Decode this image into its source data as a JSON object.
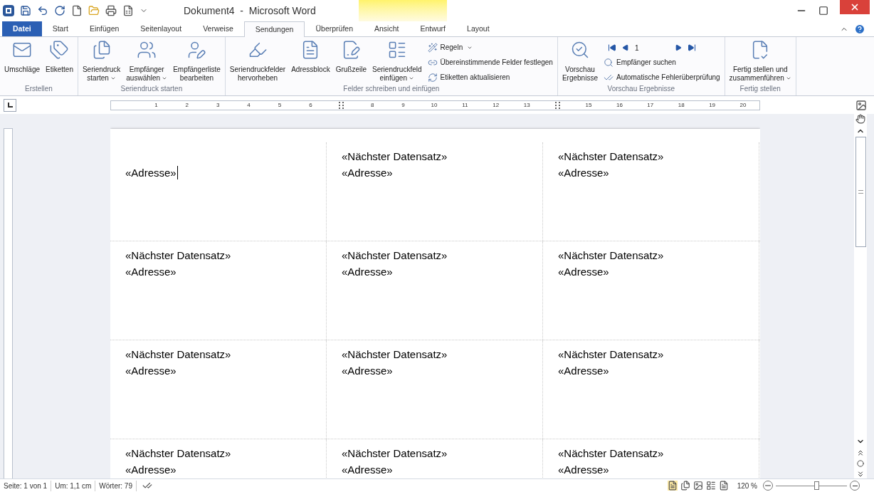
{
  "window": {
    "title": "Dokument4  -  Microsoft Word"
  },
  "tabs": [
    {
      "label": "Datei",
      "kind": "file",
      "selected": false
    },
    {
      "label": "Start",
      "kind": "tab",
      "selected": false
    },
    {
      "label": "Einfügen",
      "kind": "tab",
      "selected": false
    },
    {
      "label": "Seitenlayout",
      "kind": "tab",
      "selected": false
    },
    {
      "label": "Verweise",
      "kind": "tab",
      "selected": false
    },
    {
      "label": "Sendungen",
      "kind": "tab",
      "selected": true
    },
    {
      "label": "Überprüfen",
      "kind": "tab",
      "selected": false
    },
    {
      "label": "Ansicht",
      "kind": "tab",
      "selected": false
    },
    {
      "label": "Entwurf",
      "kind": "tab",
      "selected": false
    },
    {
      "label": "Layout",
      "kind": "tab",
      "selected": false
    }
  ],
  "ribbon": [
    {
      "label": "Erstellen",
      "items": [
        {
          "kind": "large",
          "lines": [
            "Umschläge"
          ],
          "dropdown": false
        },
        {
          "kind": "large",
          "lines": [
            "Etiketten"
          ],
          "dropdown": false
        }
      ]
    },
    {
      "label": "Seriendruck starten",
      "items": [
        {
          "kind": "large",
          "lines": [
            "Seriendruck",
            "starten"
          ],
          "dropdown": true
        },
        {
          "kind": "large",
          "lines": [
            "Empfänger",
            "auswählen"
          ],
          "dropdown": true
        },
        {
          "kind": "large",
          "lines": [
            "Empfängerliste",
            "bearbeiten"
          ],
          "dropdown": false
        }
      ]
    },
    {
      "label": "Felder schreiben und einfügen",
      "items": [
        {
          "kind": "large",
          "lines": [
            "Seriendruckfelder",
            "hervorheben"
          ],
          "dropdown": false
        },
        {
          "kind": "large",
          "lines": [
            "Adressblock"
          ],
          "dropdown": false
        },
        {
          "kind": "large",
          "lines": [
            "Grußzeile"
          ],
          "dropdown": false
        },
        {
          "kind": "large",
          "lines": [
            "Seriendruckfeld",
            "einfügen"
          ],
          "dropdown": true
        },
        {
          "kind": "small",
          "small": [
            {
              "label": "Regeln",
              "dropdown": true
            },
            {
              "label": "Übereinstimmende Felder festlegen",
              "dropdown": false
            },
            {
              "label": "Etiketten aktualisieren",
              "dropdown": false
            }
          ]
        }
      ]
    },
    {
      "label": "Vorschau Ergebnisse",
      "items": [
        {
          "kind": "large",
          "lines": [
            "Vorschau",
            "Ergebnisse"
          ],
          "dropdown": false
        },
        {
          "kind": "nav",
          "record": "1",
          "small": [
            {
              "label": "Empfänger suchen",
              "dropdown": false
            },
            {
              "label": "Automatische Fehlerüberprüfung",
              "dropdown": false
            }
          ]
        }
      ]
    },
    {
      "label": "Fertig stellen",
      "items": [
        {
          "kind": "large",
          "lines": [
            "Fertig stellen und",
            "zusammenführen"
          ],
          "dropdown": true
        }
      ]
    }
  ],
  "ruler": [
    {
      "kind": "number",
      "label": "1"
    },
    {
      "kind": "number",
      "label": "2"
    },
    {
      "kind": "number",
      "label": "3"
    },
    {
      "kind": "number",
      "label": "4"
    },
    {
      "kind": "number",
      "label": "5"
    },
    {
      "kind": "number",
      "label": "6"
    },
    {
      "kind": "column"
    },
    {
      "kind": "number",
      "label": "8"
    },
    {
      "kind": "number",
      "label": "9"
    },
    {
      "kind": "number",
      "label": "10"
    },
    {
      "kind": "number",
      "label": "11"
    },
    {
      "kind": "number",
      "label": "12"
    },
    {
      "kind": "number",
      "label": "13"
    },
    {
      "kind": "column"
    },
    {
      "kind": "number",
      "label": "15"
    },
    {
      "kind": "number",
      "label": "16"
    },
    {
      "kind": "number",
      "label": "17"
    },
    {
      "kind": "number",
      "label": "18"
    },
    {
      "kind": "number",
      "label": "19"
    },
    {
      "kind": "number",
      "label": "20"
    }
  ],
  "labels": [
    [
      {
        "lines": [
          "«Adresse»"
        ],
        "cursor": true
      },
      {
        "lines": [
          "«Nächster Datensatz»",
          "«Adresse»"
        ],
        "cursor": false
      },
      {
        "lines": [
          "«Nächster Datensatz»",
          "«Adresse»"
        ],
        "cursor": false
      }
    ],
    [
      {
        "lines": [
          "«Nächster Datensatz»",
          "«Adresse»"
        ],
        "cursor": false
      },
      {
        "lines": [
          "«Nächster Datensatz»",
          "«Adresse»"
        ],
        "cursor": false
      },
      {
        "lines": [
          "«Nächster Datensatz»",
          "«Adresse»"
        ],
        "cursor": false
      }
    ],
    [
      {
        "lines": [
          "«Nächster Datensatz»",
          "«Adresse»"
        ],
        "cursor": false
      },
      {
        "lines": [
          "«Nächster Datensatz»",
          "«Adresse»"
        ],
        "cursor": false
      },
      {
        "lines": [
          "«Nächster Datensatz»",
          "«Adresse»"
        ],
        "cursor": false
      }
    ],
    [
      {
        "lines": [
          "«Nächster Datensatz»",
          "«Adresse»"
        ],
        "cursor": false
      },
      {
        "lines": [
          "«Nächster Datensatz»",
          "«Adresse»"
        ],
        "cursor": false
      },
      {
        "lines": [
          "«Nächster Datensatz»",
          "«Adresse»"
        ],
        "cursor": false
      }
    ]
  ],
  "status_bar": {
    "items": [
      "Seite: 1 von 1",
      "Um: 1,1 cm",
      "Wörter: 79"
    ],
    "zoom": "120 %",
    "zoom_slider": {
      "level": 0.58
    }
  }
}
